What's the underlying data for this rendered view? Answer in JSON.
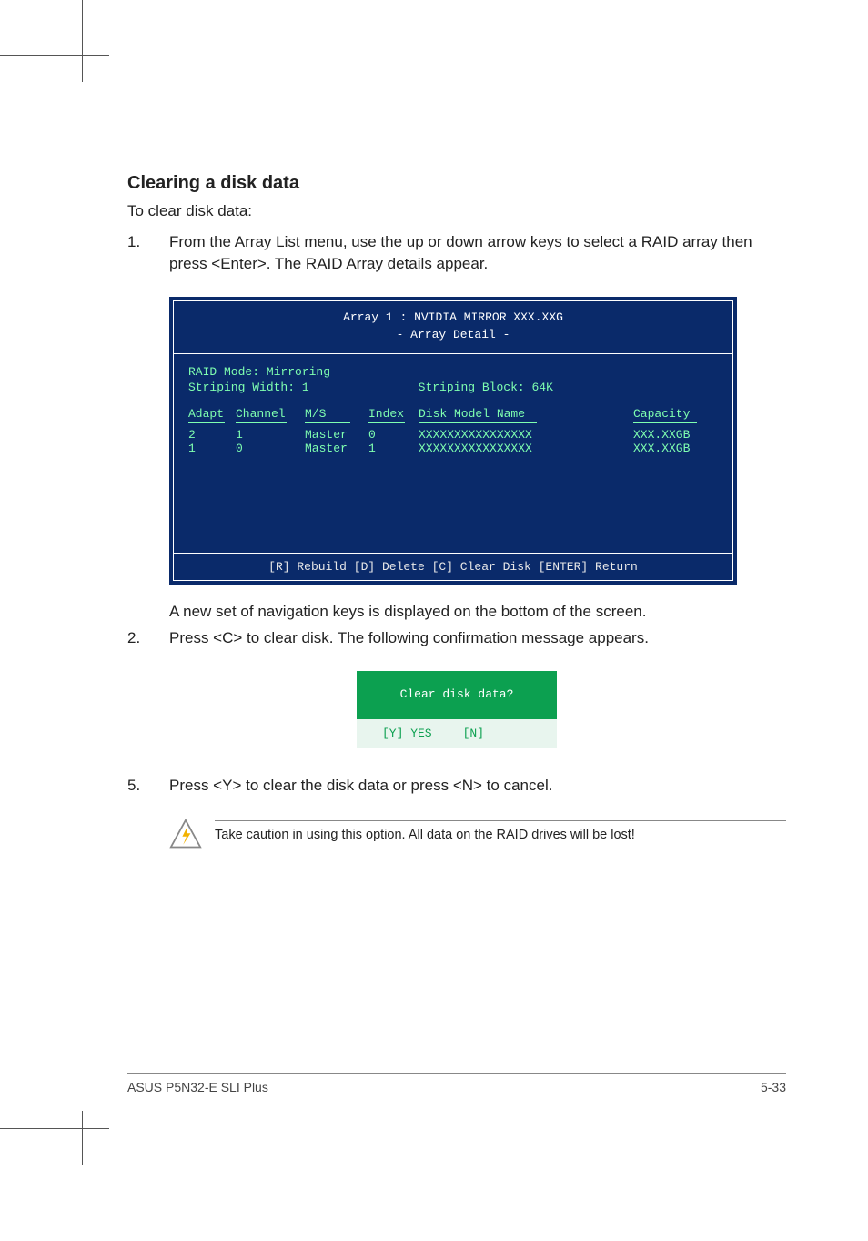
{
  "heading": "Clearing a disk data",
  "intro": "To clear disk data:",
  "steps_first": {
    "num": "1.",
    "text": "From the Array List menu, use the up or down arrow keys to select a RAID array then press <Enter>. The RAID Array details appear."
  },
  "panel": {
    "title_line1": "Array 1 : NVIDIA MIRROR  XXX.XXG",
    "title_line2": "- Array Detail -",
    "meta_mode_label": "RAID Mode:",
    "meta_mode_value": "Mirroring",
    "meta_width_label": "Striping Width:",
    "meta_width_value": "1",
    "meta_block_label": "Striping Block:",
    "meta_block_value": "64K",
    "head": {
      "adapt": "Adapt",
      "channel": "Channel",
      "ms": "M/S",
      "index": "Index",
      "model": "Disk Model Name",
      "capacity": "Capacity"
    },
    "rows": [
      {
        "adapt": "2",
        "channel": "1",
        "ms": "Master",
        "index": "0",
        "model": "XXXXXXXXXXXXXXXX",
        "capacity": "XXX.XXGB"
      },
      {
        "adapt": "1",
        "channel": "0",
        "ms": "Master",
        "index": "1",
        "model": "XXXXXXXXXXXXXXXX",
        "capacity": "XXX.XXGB"
      }
    ],
    "footer": "[R] Rebuild  [D] Delete  [C] Clear Disk  [ENTER] Return"
  },
  "after_panel_txt": "A new set of  navigation keys is displayed on the bottom of the screen.",
  "step2": {
    "num": "2.",
    "text": "Press <C> to clear disk. The following confirmation message appears."
  },
  "dialog": {
    "question": "Clear disk data?",
    "yes": "[Y] YES",
    "no": "[N]"
  },
  "step5": {
    "num": "5.",
    "text": "Press <Y> to clear the disk data or press <N> to cancel."
  },
  "note": "Take caution in using this option. All data on the RAID drives will be lost!",
  "footer_left": "ASUS P5N32-E SLI Plus",
  "footer_right": "5-33"
}
